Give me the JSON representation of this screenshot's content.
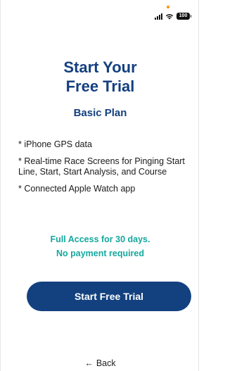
{
  "status_bar": {
    "battery_level": "100",
    "signal_icon": "cellular-signal-icon",
    "wifi_icon": "wifi-icon",
    "battery_icon": "battery-icon",
    "indicator_color": "#ff9500"
  },
  "header": {
    "title_line1": "Start Your",
    "title_line2": "Free Trial",
    "plan_name": "Basic Plan"
  },
  "features": [
    "* iPhone GPS data",
    "* Real-time Race Screens for Pinging Start Line, Start, Start Analysis, and Course",
    "* Connected Apple Watch app"
  ],
  "offer": {
    "line1": "Full Access for 30 days.",
    "line2": "No payment required"
  },
  "cta": {
    "label": "Start Free Trial"
  },
  "nav": {
    "back_arrow": "←",
    "back_label": "Back"
  },
  "colors": {
    "brand_navy": "#13417f",
    "accent_teal": "#14a89e"
  }
}
